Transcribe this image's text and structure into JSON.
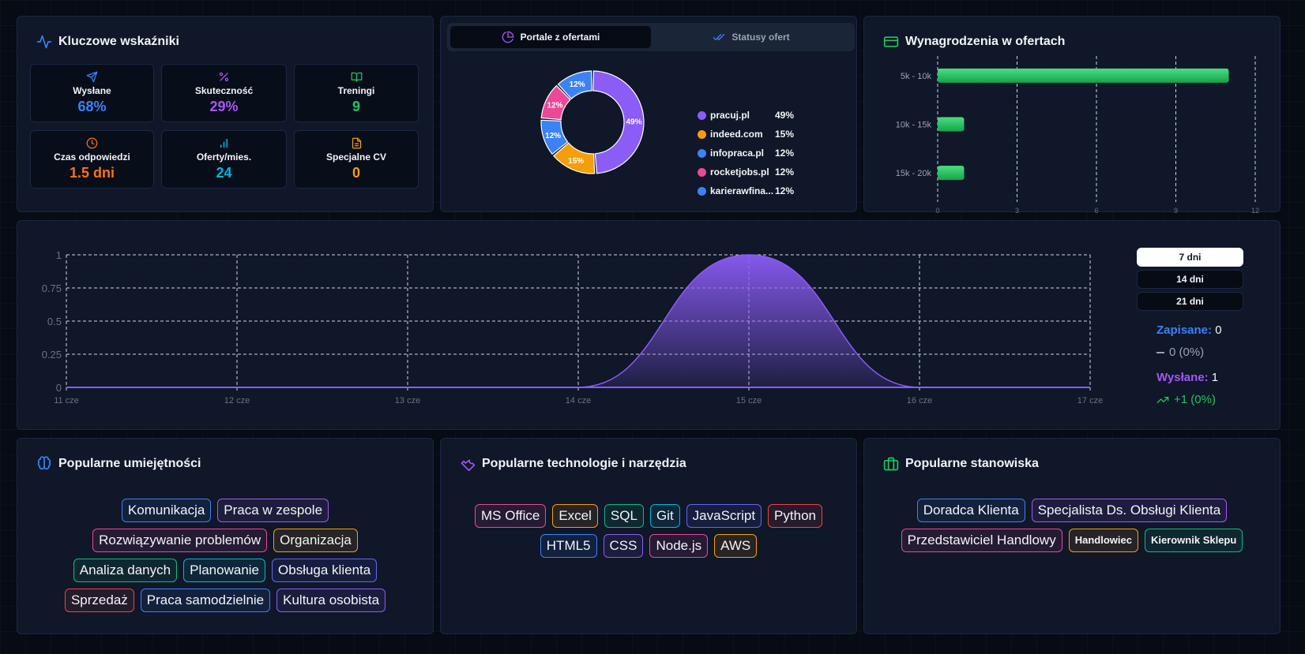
{
  "kpi": {
    "title": "Kluczowe wskaźniki",
    "items": [
      {
        "label": "Wysłane",
        "value": "68%",
        "color": "#3b82f6",
        "icon": "send-icon"
      },
      {
        "label": "Skuteczność",
        "value": "29%",
        "color": "#a855f7",
        "icon": "percent-icon"
      },
      {
        "label": "Treningi",
        "value": "9",
        "color": "#22c55e",
        "icon": "book-icon"
      },
      {
        "label": "Czas odpowiedzi",
        "value": "1.5 dni",
        "color": "#f97316",
        "icon": "clock-icon"
      },
      {
        "label": "Oferty/mies.",
        "value": "24",
        "color": "#06b6d4",
        "icon": "bar-chart-icon"
      },
      {
        "label": "Specjalne CV",
        "value": "0",
        "color": "#f59e0b",
        "icon": "document-icon"
      }
    ]
  },
  "portals": {
    "tabs": [
      {
        "label": "Portale z ofertami",
        "icon": "pie-chart-icon",
        "active": true
      },
      {
        "label": "Statusy ofert",
        "icon": "check-double-icon",
        "active": false
      }
    ]
  },
  "salary": {
    "title": "Wynagrodzenia w ofertach"
  },
  "trend": {
    "ranges": [
      "7 dni",
      "14 dni",
      "21 dni"
    ],
    "active_range": "7 dni",
    "saved_label": "Zapisane:",
    "saved_value": "0",
    "saved_change": "0 (0%)",
    "sent_label": "Wysłane:",
    "sent_value": "1",
    "sent_change": "+1 (0%)"
  },
  "skills": {
    "title": "Popularne umiejętności",
    "rows": [
      [
        {
          "t": "Komunikacja",
          "c": "#3b82f6"
        },
        {
          "t": "Praca w zespole",
          "c": "#a855f7"
        }
      ],
      [
        {
          "t": "Rozwiązywanie problemów",
          "c": "#ec4899"
        },
        {
          "t": "Organizacja",
          "c": "#f59e0b"
        }
      ],
      [
        {
          "t": "Analiza danych",
          "c": "#10b981"
        },
        {
          "t": "Planowanie",
          "c": "#06b6d4"
        },
        {
          "t": "Obsługa klienta",
          "c": "#6366f1"
        }
      ],
      [
        {
          "t": "Sprzedaż",
          "c": "#ef4444"
        },
        {
          "t": "Praca samodzielnie",
          "c": "#3b82f6"
        },
        {
          "t": "Kultura osobista",
          "c": "#8b5cf6"
        }
      ]
    ]
  },
  "tech": {
    "title": "Popularne technologie i narzędzia",
    "rows": [
      [
        {
          "t": "MS Office",
          "c": "#ec4899"
        },
        {
          "t": "Excel",
          "c": "#f59e0b"
        },
        {
          "t": "SQL",
          "c": "#10b981"
        },
        {
          "t": "Git",
          "c": "#06b6d4"
        },
        {
          "t": "JavaScript",
          "c": "#6366f1"
        },
        {
          "t": "Python",
          "c": "#ef4444"
        }
      ],
      [
        {
          "t": "HTML5",
          "c": "#3b82f6"
        },
        {
          "t": "CSS",
          "c": "#8b5cf6"
        },
        {
          "t": "Node.js",
          "c": "#ec4899"
        },
        {
          "t": "AWS",
          "c": "#f59e0b"
        }
      ]
    ]
  },
  "positions": {
    "title": "Popularne stanowiska",
    "rows": [
      [
        {
          "t": "Doradca Klienta",
          "c": "#3b82f6"
        },
        {
          "t": "Specjalista Ds. Obsługi Klienta",
          "c": "#a855f7"
        }
      ],
      [
        {
          "t": "Przedstawiciel Handlowy",
          "c": "#ec4899"
        },
        {
          "t": "Handlowiec",
          "c": "#f59e0b",
          "small": true
        },
        {
          "t": "Kierownik Sklepu",
          "c": "#10b981",
          "small": true
        }
      ]
    ]
  },
  "chart_data": [
    {
      "type": "pie",
      "labels": [
        "pracuj.pl",
        "indeed.com",
        "infopraca.pl",
        "rocketjobs.pl",
        "karierawfina..."
      ],
      "values": [
        49,
        15,
        12,
        12,
        12
      ],
      "value_labels": [
        "49%",
        "15%",
        "12%",
        "12%",
        "12%"
      ],
      "colors": [
        "#8b5cf6",
        "#f59e0b",
        "#3b82f6",
        "#ec4899",
        "#3b82f6"
      ],
      "donut": true,
      "legend": "right"
    },
    {
      "type": "bar",
      "orientation": "horizontal",
      "categories": [
        "5k - 10k",
        "10k - 15k",
        "15k - 20k"
      ],
      "values": [
        11,
        1,
        1
      ],
      "xlim": [
        0,
        12
      ],
      "xticks": [
        0,
        3,
        6,
        9,
        12
      ],
      "color": "#22c55e",
      "grid": "vertical dashed"
    },
    {
      "type": "area",
      "x": [
        "11 cze",
        "12 cze",
        "13 cze",
        "14 cze",
        "15 cze",
        "16 cze",
        "17 cze"
      ],
      "series": [
        {
          "name": "Wysłane",
          "values": [
            0,
            0,
            0,
            0,
            1,
            0,
            0
          ],
          "color": "#8b5cf6"
        }
      ],
      "ylim": [
        0,
        1
      ],
      "yticks": [
        "0",
        "0.25",
        "0.5",
        "0.75",
        "1"
      ],
      "grid": true
    }
  ]
}
